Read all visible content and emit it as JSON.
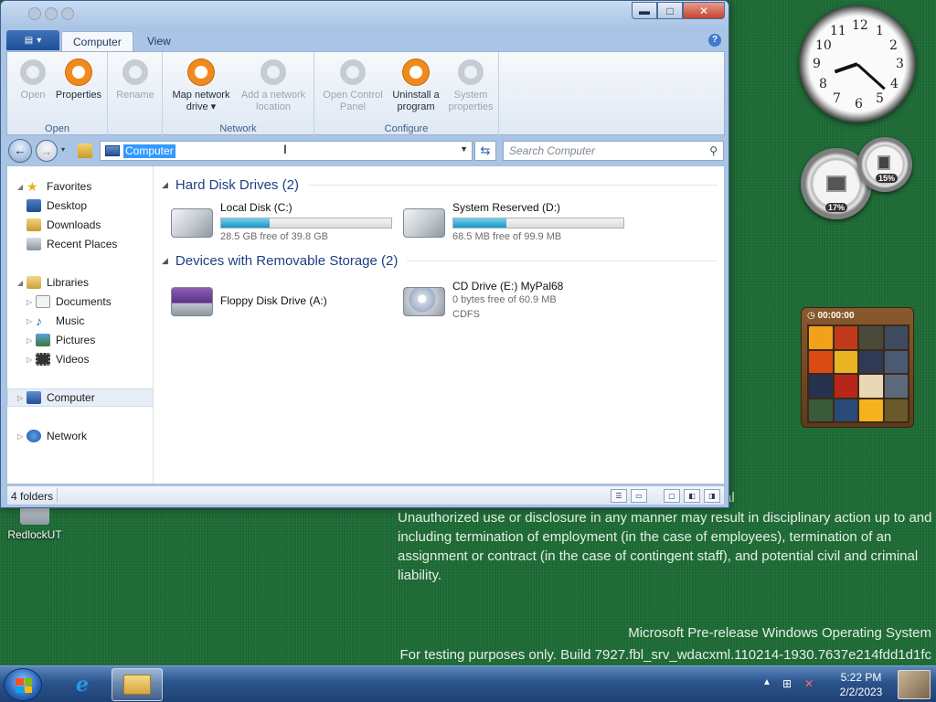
{
  "desktop": {
    "confidential_fragment": "al",
    "legal_text": "Unauthorized use or disclosure in any manner may result in disciplinary action up to and including termination of employment (in the case of employees), termination of an assignment or contract (in the case of contingent staff), and potential civil and criminal liability.",
    "build_line1": "Microsoft Pre-release Windows Operating System",
    "build_line2": "For testing purposes only. Build 7927.fbl_srv_wdacxml.110214-1930.7637e214fdd1d1fc",
    "icon_label": "RedlockUT"
  },
  "ribbon": {
    "tabs": [
      "Computer",
      "View"
    ],
    "groups": [
      {
        "label": "Open",
        "buttons": [
          {
            "label": "Open",
            "enabled": false
          },
          {
            "label": "Properties",
            "enabled": true
          }
        ]
      },
      {
        "label": "",
        "buttons": [
          {
            "label": "Rename",
            "enabled": false
          }
        ]
      },
      {
        "label": "Network",
        "buttons": [
          {
            "label": "Map network drive ▾",
            "enabled": true
          },
          {
            "label": "Add a network location",
            "enabled": false
          }
        ]
      },
      {
        "label": "Configure",
        "buttons": [
          {
            "label": "Open Control Panel",
            "enabled": false
          },
          {
            "label": "Uninstall a program",
            "enabled": true
          },
          {
            "label": "System properties",
            "enabled": false
          }
        ]
      }
    ],
    "accent_color": "#f08a1c"
  },
  "address": {
    "path": "Computer",
    "search_placeholder": "Search Computer"
  },
  "nav": {
    "favorites": "Favorites",
    "desktop": "Desktop",
    "downloads": "Downloads",
    "recent": "Recent Places",
    "libraries": "Libraries",
    "documents": "Documents",
    "music": "Music",
    "pictures": "Pictures",
    "videos": "Videos",
    "computer": "Computer",
    "network": "Network"
  },
  "content": {
    "hdd_header": "Hard Disk Drives (2)",
    "removable_header": "Devices with Removable Storage (2)",
    "drives": [
      {
        "name": "Local Disk (C:)",
        "free_text": "28.5 GB free of 39.8 GB",
        "used_fraction": 0.284
      },
      {
        "name": "System Reserved (D:)",
        "free_text": "68.5 MB free of 99.9 MB",
        "used_fraction": 0.314
      }
    ],
    "removable": [
      {
        "name": "Floppy Disk Drive (A:)"
      },
      {
        "name": "CD Drive (E:) MyPal68",
        "free_text": "0 bytes free of 60.9 MB",
        "fs": "CDFS"
      }
    ]
  },
  "status": {
    "items": "4 folders"
  },
  "gadgets": {
    "cpu_percent": "17%",
    "mem_percent": "15%",
    "puzzle_timer": "00:00:00"
  },
  "taskbar": {
    "time": "5:22 PM",
    "date": "2/2/2023"
  }
}
